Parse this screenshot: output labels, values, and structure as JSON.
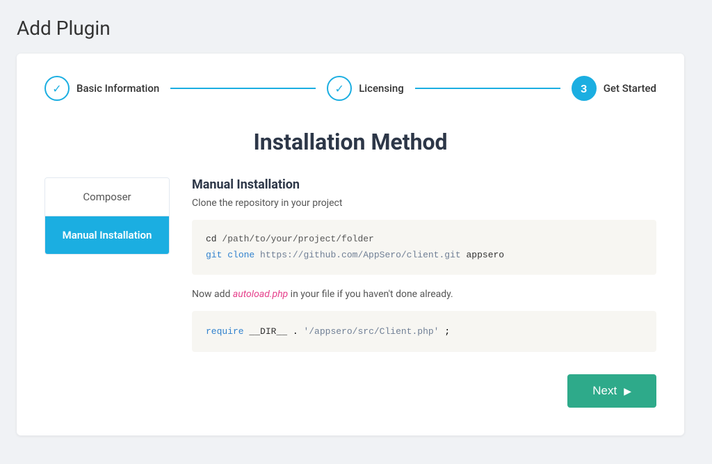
{
  "page": {
    "title": "Add Plugin"
  },
  "stepper": {
    "steps": [
      {
        "id": "basic-info",
        "label": "Basic Information",
        "state": "completed",
        "icon": "✓"
      },
      {
        "id": "licensing",
        "label": "Licensing",
        "state": "completed",
        "icon": "✓"
      },
      {
        "id": "get-started",
        "label": "Get Started",
        "state": "active",
        "number": "3"
      }
    ]
  },
  "section": {
    "title": "Installation Method"
  },
  "tabs": [
    {
      "id": "composer",
      "label": "Composer",
      "active": false
    },
    {
      "id": "manual",
      "label": "Manual Installation",
      "active": true
    }
  ],
  "manual": {
    "heading": "Manual Installation",
    "description": "Clone the repository in your project",
    "code1_line1": "cd /path/to/your/project/folder",
    "code1_line2_prefix": "git clone ",
    "code1_line2_url": "https://github.com/AppSero/client.git",
    "code1_line2_suffix": " appsero",
    "note_prefix": "Now add ",
    "note_highlight": "autoload.php",
    "note_suffix": " in your file if you haven't done already.",
    "code2": "require __DIR__ . '/appsero/src/Client.php';"
  },
  "footer": {
    "next_label": "Next",
    "next_arrow": "▶"
  }
}
